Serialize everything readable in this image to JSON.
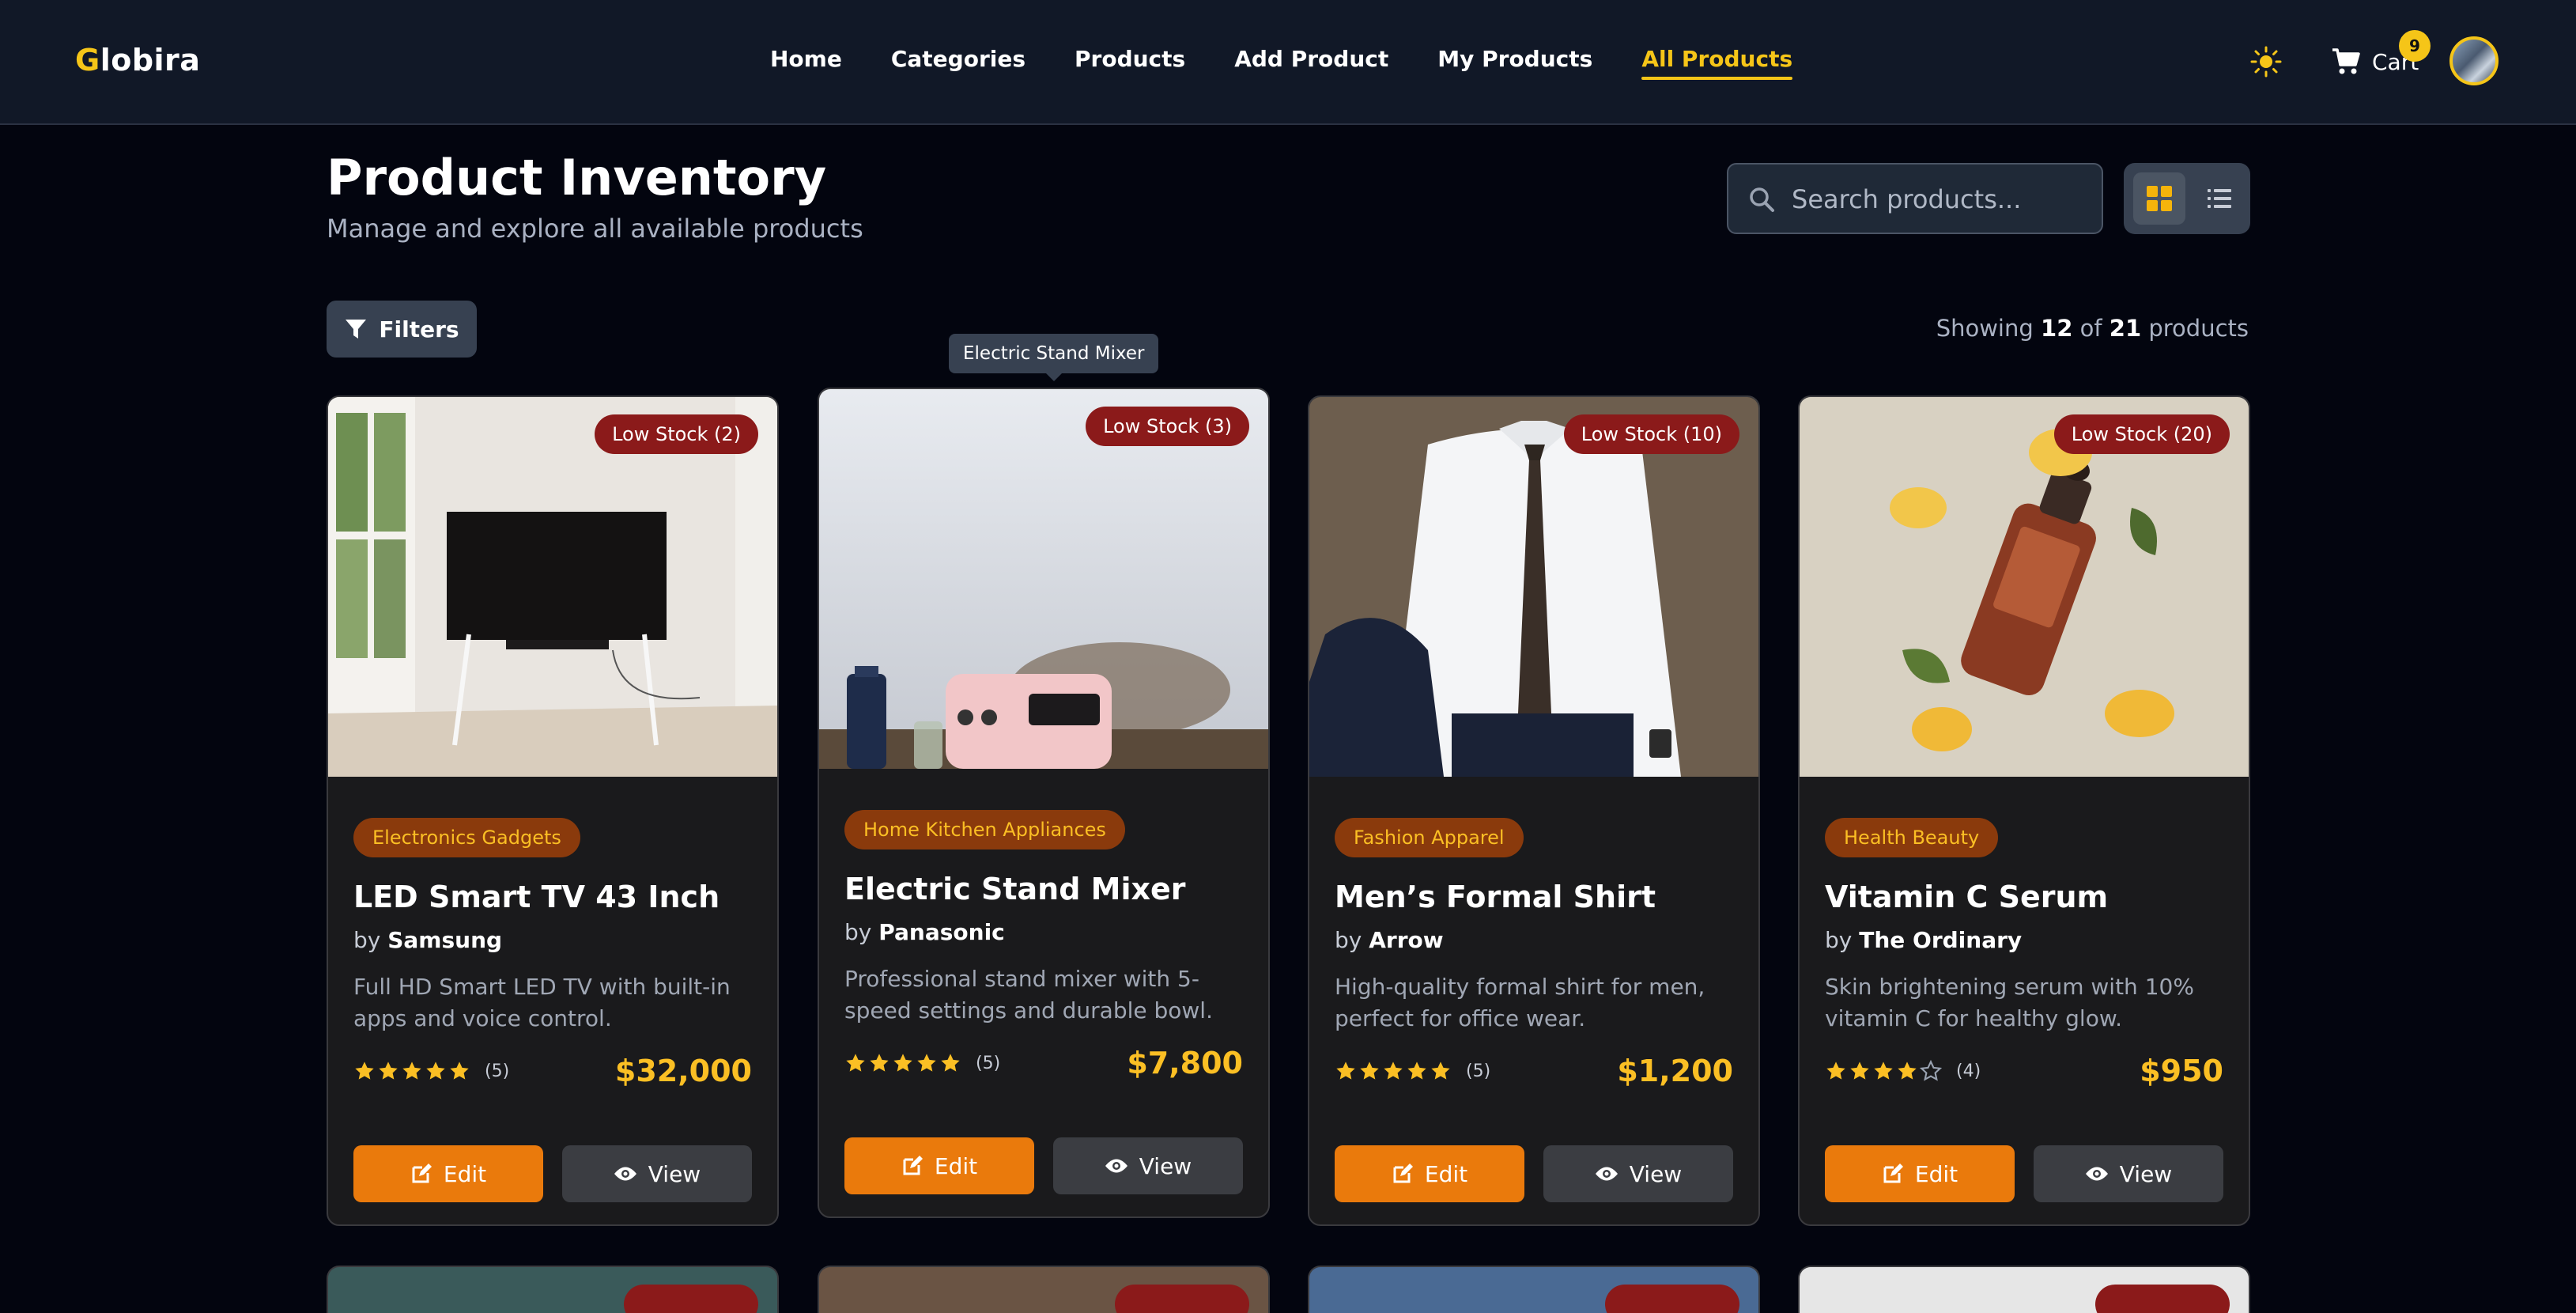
{
  "brand": {
    "logo_first": "G",
    "logo_rest": "lobira"
  },
  "nav": {
    "links": [
      "Home",
      "Categories",
      "Products",
      "Add Product",
      "My Products",
      "All Products"
    ],
    "active": "All Products",
    "cart_label": "Cart",
    "cart_count": "9"
  },
  "header": {
    "title": "Product Inventory",
    "subtitle": "Manage and explore all available products",
    "search_placeholder": "Search products..."
  },
  "toolbar": {
    "filters_label": "Filters",
    "showing_prefix": "Showing",
    "showing_count": "12",
    "showing_of": "of",
    "showing_total": "21",
    "showing_suffix": "products"
  },
  "tooltip": "Electric Stand Mixer",
  "products": [
    {
      "stock": "Low Stock (2)",
      "category": "Electronics Gadgets",
      "name": "LED Smart TV 43 Inch",
      "by": "by",
      "brand": "Samsung",
      "description": "Full HD Smart LED TV with built-in apps and voice control.",
      "rating": 5,
      "rating_label": "(5)",
      "price": "$32,000",
      "edit_label": "Edit",
      "view_label": "View"
    },
    {
      "stock": "Low Stock (3)",
      "category": "Home Kitchen Appliances",
      "name": "Electric Stand Mixer",
      "by": "by",
      "brand": "Panasonic",
      "description": "Professional stand mixer with 5-speed settings and durable bowl.",
      "rating": 5,
      "rating_label": "(5)",
      "price": "$7,800",
      "edit_label": "Edit",
      "view_label": "View"
    },
    {
      "stock": "Low Stock (10)",
      "category": "Fashion Apparel",
      "name": "Men’s Formal Shirt",
      "by": "by",
      "brand": "Arrow",
      "description": "High-quality formal shirt for men, perfect for office wear.",
      "rating": 5,
      "rating_label": "(5)",
      "price": "$1,200",
      "edit_label": "Edit",
      "view_label": "View"
    },
    {
      "stock": "Low Stock (20)",
      "category": "Health Beauty",
      "name": "Vitamin C Serum",
      "by": "by",
      "brand": "The Ordinary",
      "description": "Skin brightening serum with 10% vitamin C for healthy glow.",
      "rating": 4,
      "rating_label": "(4)",
      "price": "$950",
      "edit_label": "Edit",
      "view_label": "View"
    }
  ],
  "colors": {
    "accent": "#f5c518",
    "edit_button": "#ea7a0c",
    "stock_badge": "#8b1a1a",
    "category_badge": "#8a3a0c",
    "price": "#fbbf24"
  },
  "icons": {
    "theme": "sun-icon",
    "cart": "cart-icon",
    "search": "search-icon",
    "grid": "grid-view-icon",
    "list": "list-view-icon",
    "filter": "filter-icon",
    "edit": "edit-icon",
    "view": "eye-icon",
    "star": "star-icon"
  }
}
